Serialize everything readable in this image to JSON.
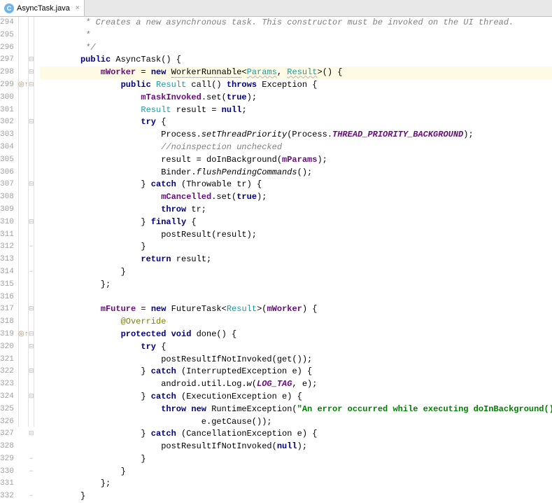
{
  "tab": {
    "icon_letter": "C",
    "filename": "AsyncTask.java",
    "close": "×"
  },
  "gutter_start": 294,
  "gutter_end": 332,
  "highlighted_line": 298,
  "markers": {
    "299": "◎↑",
    "319": "◎↑"
  },
  "fold_icons": {
    "297": "⊟",
    "298": "⊟",
    "299": "⊟",
    "302": "⊟",
    "307": "⊟",
    "310": "⊟",
    "312": "−",
    "314": "−",
    "317": "⊟",
    "319": "⊟",
    "320": "⊟",
    "322": "⊟",
    "324": "⊟",
    "327": "⊟",
    "329": "−",
    "330": "−",
    "332": "−"
  },
  "code": {
    "294": [
      {
        "t": "         * ",
        "c": "c-comment"
      },
      {
        "t": "Creates a new asynchronous task. This constructor must be invoked on the UI thread.",
        "c": "c-comment"
      }
    ],
    "295": [
      {
        "t": "         *",
        "c": "c-comment"
      }
    ],
    "296": [
      {
        "t": "         */",
        "c": "c-comment"
      }
    ],
    "297": [
      {
        "t": "        "
      },
      {
        "t": "public",
        "c": "c-kw"
      },
      {
        "t": " AsyncTask() {"
      }
    ],
    "298": [
      {
        "t": "            "
      },
      {
        "t": "mWorker",
        "c": "c-field"
      },
      {
        "t": " = "
      },
      {
        "t": "new",
        "c": "c-kw"
      },
      {
        "t": " "
      },
      {
        "t": "WorkerRunnable",
        "c": "c-underline-dots"
      },
      {
        "t": "<"
      },
      {
        "t": "Params",
        "c": "c-generic"
      },
      {
        "t": ", "
      },
      {
        "t": "Result",
        "c": "c-generic"
      },
      {
        "t": ">() {"
      }
    ],
    "299": [
      {
        "t": "                "
      },
      {
        "t": "public",
        "c": "c-kw"
      },
      {
        "t": " "
      },
      {
        "t": "Result",
        "c": "c-type"
      },
      {
        "t": " call() "
      },
      {
        "t": "throws",
        "c": "c-kw"
      },
      {
        "t": " Exception {"
      }
    ],
    "300": [
      {
        "t": "                    "
      },
      {
        "t": "mTaskInvoked",
        "c": "c-field"
      },
      {
        "t": ".set("
      },
      {
        "t": "true",
        "c": "c-kw"
      },
      {
        "t": ");"
      }
    ],
    "301": [
      {
        "t": "                    "
      },
      {
        "t": "Result",
        "c": "c-type"
      },
      {
        "t": " result = "
      },
      {
        "t": "null",
        "c": "c-kw"
      },
      {
        "t": ";"
      }
    ],
    "302": [
      {
        "t": "                    "
      },
      {
        "t": "try",
        "c": "c-kw"
      },
      {
        "t": " {"
      }
    ],
    "303": [
      {
        "t": "                        Process."
      },
      {
        "t": "setThreadPriority",
        "c": "c-static"
      },
      {
        "t": "(Process."
      },
      {
        "t": "THREAD_PRIORITY_BACKGROUND",
        "c": "c-const"
      },
      {
        "t": ");"
      }
    ],
    "304": [
      {
        "t": "                        "
      },
      {
        "t": "//noinspection unchecked",
        "c": "c-comment"
      }
    ],
    "305": [
      {
        "t": "                        result = doInBackground("
      },
      {
        "t": "mParams",
        "c": "c-field"
      },
      {
        "t": ");"
      }
    ],
    "306": [
      {
        "t": "                        Binder."
      },
      {
        "t": "flushPendingCommands",
        "c": "c-static"
      },
      {
        "t": "();"
      }
    ],
    "307": [
      {
        "t": "                    } "
      },
      {
        "t": "catch",
        "c": "c-kw"
      },
      {
        "t": " (Throwable tr) {"
      }
    ],
    "308": [
      {
        "t": "                        "
      },
      {
        "t": "mCancelled",
        "c": "c-field"
      },
      {
        "t": ".set("
      },
      {
        "t": "true",
        "c": "c-kw"
      },
      {
        "t": ");"
      }
    ],
    "309": [
      {
        "t": "                        "
      },
      {
        "t": "throw",
        "c": "c-kw"
      },
      {
        "t": " tr;"
      }
    ],
    "310": [
      {
        "t": "                    } "
      },
      {
        "t": "finally",
        "c": "c-kw"
      },
      {
        "t": " {"
      }
    ],
    "311": [
      {
        "t": "                        postResult(result);"
      }
    ],
    "312": [
      {
        "t": "                    }"
      }
    ],
    "313": [
      {
        "t": "                    "
      },
      {
        "t": "return",
        "c": "c-kw"
      },
      {
        "t": " result;"
      }
    ],
    "314": [
      {
        "t": "                }"
      }
    ],
    "315": [
      {
        "t": "            };"
      }
    ],
    "316": [
      {
        "t": ""
      }
    ],
    "317": [
      {
        "t": "            "
      },
      {
        "t": "mFuture",
        "c": "c-field"
      },
      {
        "t": " = "
      },
      {
        "t": "new",
        "c": "c-kw"
      },
      {
        "t": " FutureTask<"
      },
      {
        "t": "Result",
        "c": "c-type"
      },
      {
        "t": ">("
      },
      {
        "t": "mWorker",
        "c": "c-field"
      },
      {
        "t": ") {"
      }
    ],
    "318": [
      {
        "t": "                "
      },
      {
        "t": "@Override",
        "c": "c-anno"
      }
    ],
    "319": [
      {
        "t": "                "
      },
      {
        "t": "protected",
        "c": "c-kw"
      },
      {
        "t": " "
      },
      {
        "t": "void",
        "c": "c-kw"
      },
      {
        "t": " done() {"
      }
    ],
    "320": [
      {
        "t": "                    "
      },
      {
        "t": "try",
        "c": "c-kw"
      },
      {
        "t": " {"
      }
    ],
    "321": [
      {
        "t": "                        postResultIfNotInvoked(get());"
      }
    ],
    "322": [
      {
        "t": "                    } "
      },
      {
        "t": "catch",
        "c": "c-kw"
      },
      {
        "t": " (InterruptedException e) {"
      }
    ],
    "323": [
      {
        "t": "                        android.util.Log."
      },
      {
        "t": "w",
        "c": "c-static"
      },
      {
        "t": "("
      },
      {
        "t": "LOG_TAG",
        "c": "c-const"
      },
      {
        "t": ", e);"
      }
    ],
    "324": [
      {
        "t": "                    } "
      },
      {
        "t": "catch",
        "c": "c-kw"
      },
      {
        "t": " (ExecutionException e) {"
      }
    ],
    "325": [
      {
        "t": "                        "
      },
      {
        "t": "throw",
        "c": "c-kw"
      },
      {
        "t": " "
      },
      {
        "t": "new",
        "c": "c-kw"
      },
      {
        "t": " RuntimeException("
      },
      {
        "t": "\"An error occurred while executing doInBackground()\"",
        "c": "c-string"
      },
      {
        "t": ","
      }
    ],
    "326": [
      {
        "t": "                                e.getCause());"
      }
    ],
    "327": [
      {
        "t": "                    } "
      },
      {
        "t": "catch",
        "c": "c-kw"
      },
      {
        "t": " (CancellationException e) {"
      }
    ],
    "328": [
      {
        "t": "                        postResultIfNotInvoked("
      },
      {
        "t": "null",
        "c": "c-kw"
      },
      {
        "t": ");"
      }
    ],
    "329": [
      {
        "t": "                    }"
      }
    ],
    "330": [
      {
        "t": "                }"
      }
    ],
    "331": [
      {
        "t": "            };"
      }
    ],
    "332": [
      {
        "t": "        }"
      }
    ]
  }
}
